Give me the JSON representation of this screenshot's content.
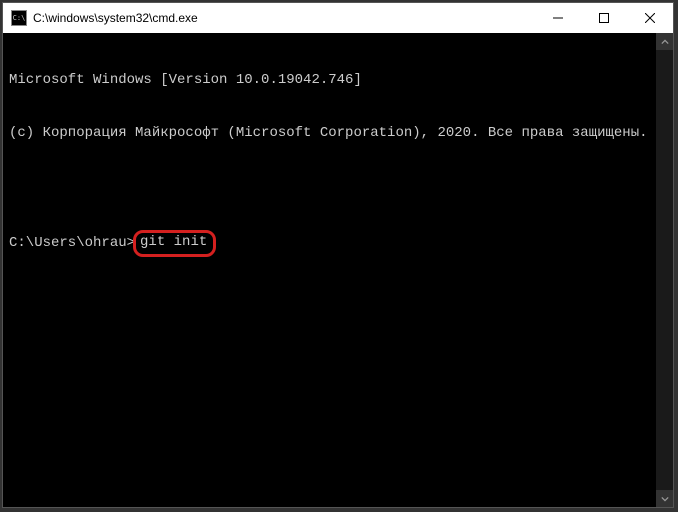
{
  "titlebar": {
    "title": "C:\\windows\\system32\\cmd.exe",
    "icon_glyph": "C:\\"
  },
  "terminal": {
    "line1": "Microsoft Windows [Version 10.0.19042.746]",
    "line2": "(c) Корпорация Майкрософт (Microsoft Corporation), 2020. Все права защищены.",
    "prompt": "C:\\Users\\ohrau>",
    "command": "git init"
  },
  "colors": {
    "bg": "#000000",
    "fg": "#cccccc",
    "highlight": "#d4201f"
  }
}
